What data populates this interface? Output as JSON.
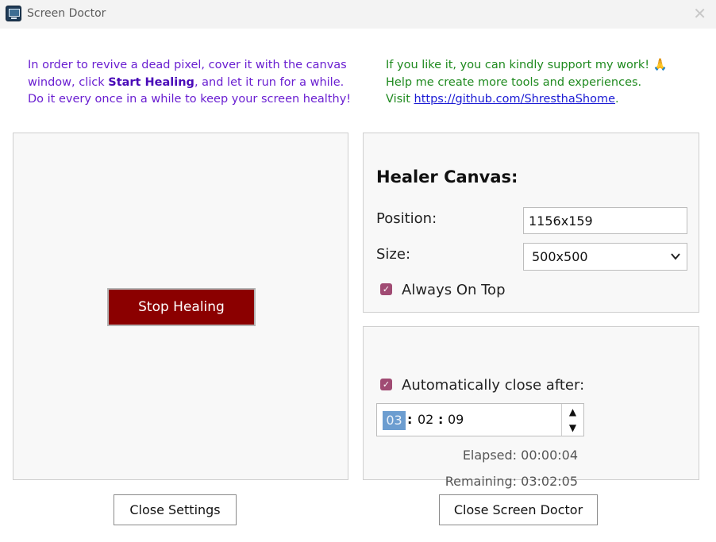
{
  "window": {
    "title": "Screen Doctor",
    "close_glyph": "✕"
  },
  "info_left": {
    "line1": "In order to revive a dead pixel, cover it with the canvas",
    "line2_prefix": "window, click ",
    "line2_bold": "Start Healing",
    "line2_suffix": ", and let it run for a while.",
    "line3": "Do it every once in a while to keep your screen healthy!"
  },
  "info_right": {
    "line1": "If you like it, you can kindly support my work!",
    "line1_icon": "🙏",
    "line2": "Help me create more tools and experiences.",
    "line3_prefix": "Visit ",
    "link": "https://github.com/ShresthaShome",
    "line3_suffix": "."
  },
  "healing": {
    "button_label": "Stop Healing",
    "button_color": "#8b0000"
  },
  "canvas": {
    "heading": "Healer Canvas:",
    "position_label": "Position:",
    "position_value": "1156x159",
    "size_label": "Size:",
    "size_value": "500x500",
    "always_on_top_label": "Always On Top",
    "always_on_top_checked": true
  },
  "timer": {
    "auto_close_label": "Automatically close after:",
    "auto_close_checked": true,
    "hours": "03",
    "minutes": "02",
    "seconds": "09",
    "separator": ":",
    "elapsed": "Elapsed: 00:00:04",
    "remaining": "Remaining: 03:02:05"
  },
  "buttons": {
    "close_settings": "Close Settings",
    "close_app": "Close Screen Doctor"
  },
  "colors": {
    "checkbox_accent": "#a04b73",
    "info_left_text": "#6a1fd1",
    "info_right_text": "#1f8a1f"
  },
  "icons": {
    "app": "monitor-icon",
    "pray": "praying-hands-icon",
    "spin_up": "▲",
    "spin_down": "▼",
    "select_chevron": "⌄"
  }
}
